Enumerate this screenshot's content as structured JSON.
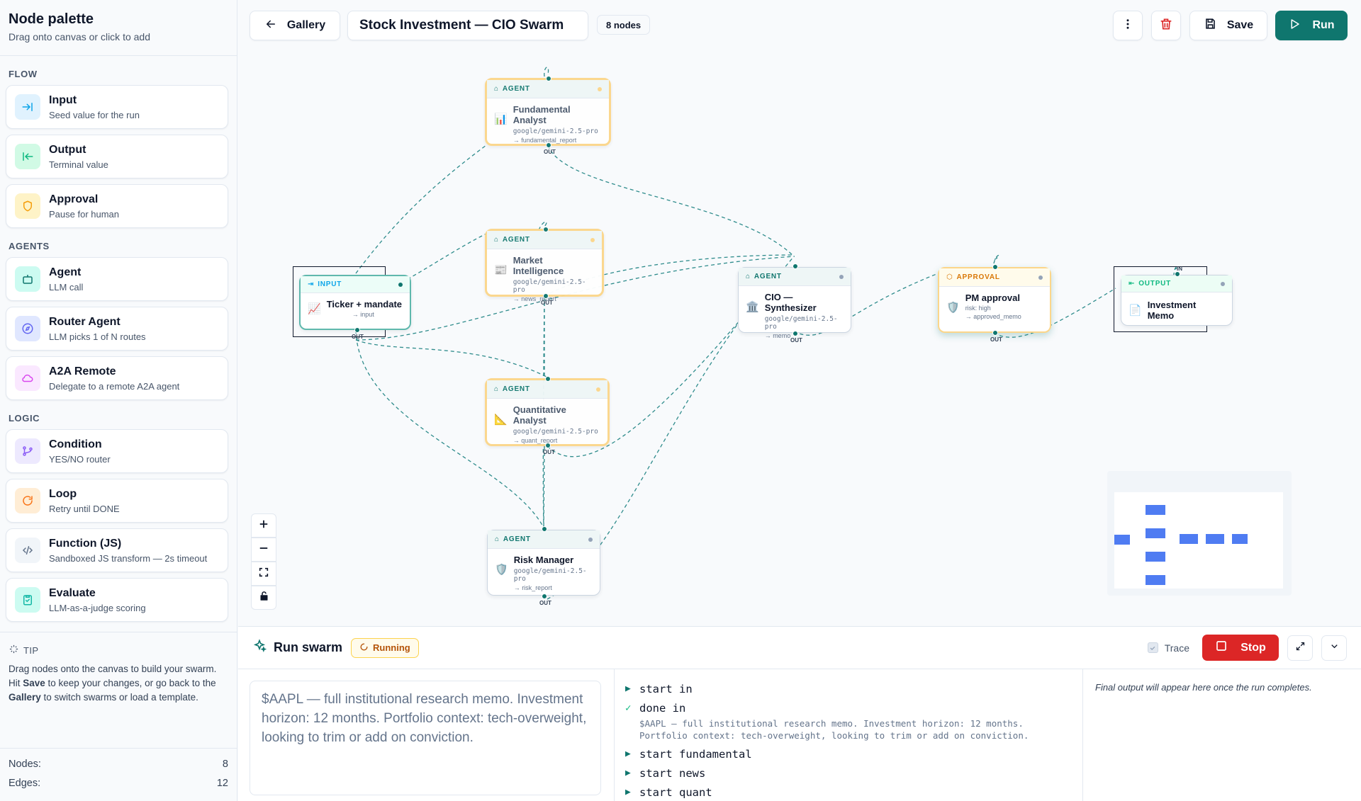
{
  "sidebar": {
    "title": "Node palette",
    "subtitle": "Drag onto canvas or click to add",
    "sections": [
      {
        "label": "FLOW",
        "items": [
          {
            "name": "Input",
            "desc": "Seed value for the run",
            "icon": "arrow-into-icon",
            "color": "#0ea5e9"
          },
          {
            "name": "Output",
            "desc": "Terminal value",
            "icon": "arrow-out-icon",
            "color": "#10b981"
          },
          {
            "name": "Approval",
            "desc": "Pause for human",
            "icon": "shield-icon",
            "color": "#f59e0b"
          }
        ]
      },
      {
        "label": "AGENTS",
        "items": [
          {
            "name": "Agent",
            "desc": "LLM call",
            "icon": "robot-icon",
            "color": "#0f766e"
          },
          {
            "name": "Router Agent",
            "desc": "LLM picks 1 of N routes",
            "icon": "compass-icon",
            "color": "#6366f1"
          },
          {
            "name": "A2A Remote",
            "desc": "Delegate to a remote A2A agent",
            "icon": "cloud-icon",
            "color": "#d946ef"
          }
        ]
      },
      {
        "label": "LOGIC",
        "items": [
          {
            "name": "Condition",
            "desc": "YES/NO router",
            "icon": "branch-icon",
            "color": "#8b5cf6"
          },
          {
            "name": "Loop",
            "desc": "Retry until DONE",
            "icon": "loop-icon",
            "color": "#f97316"
          },
          {
            "name": "Function (JS)",
            "desc": "Sandboxed JS transform — 2s timeout",
            "icon": "code-icon",
            "color": "#64748b"
          },
          {
            "name": "Evaluate",
            "desc": "LLM-as-a-judge scoring",
            "icon": "clipboard-check-icon",
            "color": "#14b8a6"
          }
        ]
      }
    ],
    "tip": {
      "label": "TIP",
      "text_1": "Drag nodes onto the canvas to build your swarm. Hit ",
      "save_word": "Save",
      "text_2": " to keep your changes, or go back to the ",
      "gallery_word": "Gallery",
      "text_3": " to switch swarms or load a template."
    },
    "stats": {
      "nodes_label": "Nodes:",
      "nodes": "8",
      "edges_label": "Edges:",
      "edges": "12"
    }
  },
  "toolbar": {
    "back_label": "Gallery",
    "swarm_name": "Stock Investment — CIO Swarm",
    "node_count": "8 nodes",
    "save_label": "Save",
    "run_label": "Run"
  },
  "nodes": {
    "fundamental": {
      "kind": "AGENT",
      "title": "Fundamental Analyst",
      "model": "google/gemini-2.5-pro",
      "output": "→ fundamental_report",
      "emoji": "📊"
    },
    "market": {
      "kind": "AGENT",
      "title": "Market Intelligence",
      "model": "google/gemini-2.5-pro",
      "output": "→ news_report",
      "emoji": "📰"
    },
    "quant": {
      "kind": "AGENT",
      "title": "Quantitative Analyst",
      "model": "google/gemini-2.5-pro",
      "output": "→ quant_report",
      "emoji": "📐"
    },
    "risk": {
      "kind": "AGENT",
      "title": "Risk Manager",
      "model": "google/gemini-2.5-pro",
      "output": "→ risk_report",
      "emoji": "🛡️"
    },
    "input": {
      "kind": "INPUT",
      "title": "Ticker + mandate",
      "output": "→ input",
      "emoji": "📈"
    },
    "cio": {
      "kind": "AGENT",
      "title": "CIO — Synthesizer",
      "model": "google/gemini-2.5-pro",
      "output": "→ memo",
      "emoji": "🏛️"
    },
    "pm": {
      "kind": "APPROVAL",
      "title": "PM approval",
      "model": "risk: high",
      "output": "→ approved_memo",
      "emoji": "🛡️"
    },
    "output": {
      "kind": "OUTPUT",
      "title": "Investment Memo",
      "emoji": "📄"
    }
  },
  "ports": {
    "out": "OUT",
    "in": "IN"
  },
  "run": {
    "title": "Run swarm",
    "status": "Running",
    "trace_label": "Trace",
    "stop_label": "Stop",
    "prompt": "$AAPL — full institutional research memo. Investment horizon: 12 months. Portfolio context: tech-overweight, looking to trim or add on conviction.",
    "log": [
      {
        "mark": "▶",
        "verb": "start",
        "node": "in"
      },
      {
        "mark": "✓",
        "verb": "done",
        "node": "in"
      },
      {
        "mark": "▶",
        "verb": "start",
        "node": "fundamental"
      },
      {
        "mark": "▶",
        "verb": "start",
        "node": "news"
      },
      {
        "mark": "▶",
        "verb": "start",
        "node": "quant"
      }
    ],
    "done_detail_1": "$AAPL — full institutional research memo. Investment horizon: 12 months.",
    "done_detail_2": "Portfolio context: tech-overweight, looking to trim or add on conviction.",
    "final_placeholder": "Final output will appear here once the run completes."
  },
  "colors": {
    "accent": "#0f766e",
    "danger": "#dc2626",
    "amber": "#f59e0b",
    "minimap_node": "#4f7cf2"
  }
}
